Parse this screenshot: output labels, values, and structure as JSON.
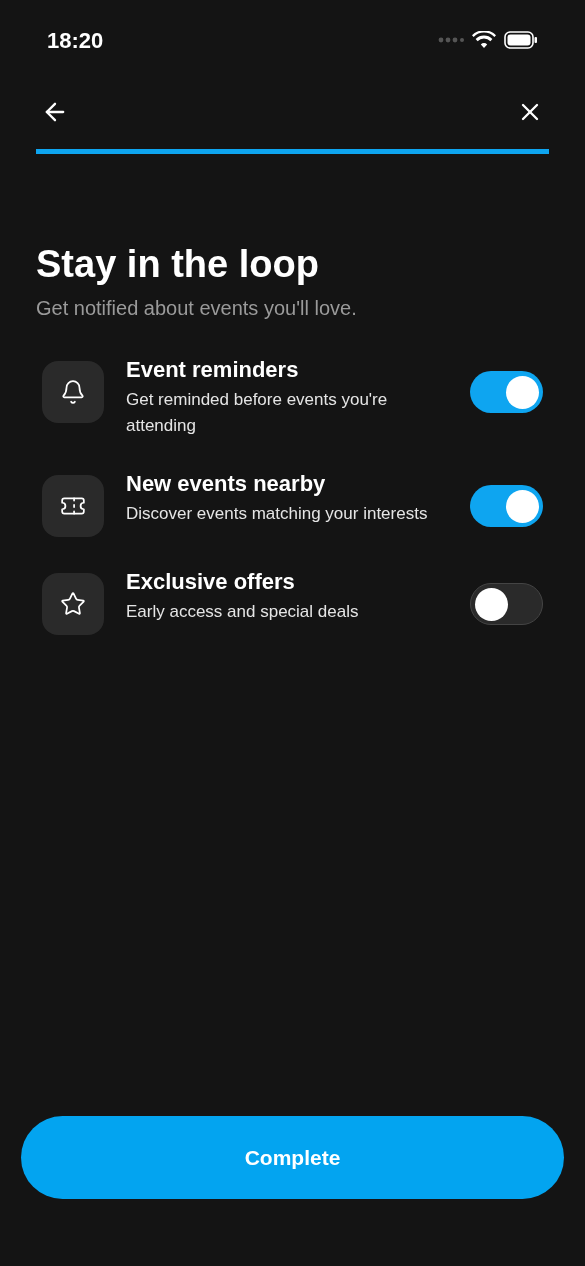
{
  "status_bar": {
    "time": "18:20"
  },
  "progress": {
    "level": 1
  },
  "title": "Stay in the loop",
  "subtitle": "Get notified about events you'll love.",
  "options": [
    {
      "kind": "bell",
      "title": "Event reminders",
      "description": "Get reminded before events you're attending",
      "on": true
    },
    {
      "kind": "ticket",
      "title": "New events nearby",
      "description": "Discover events matching your interests",
      "on": true
    },
    {
      "kind": "star",
      "title": "Exclusive offers",
      "description": "Early access and special deals",
      "on": false
    }
  ],
  "button": "Complete"
}
